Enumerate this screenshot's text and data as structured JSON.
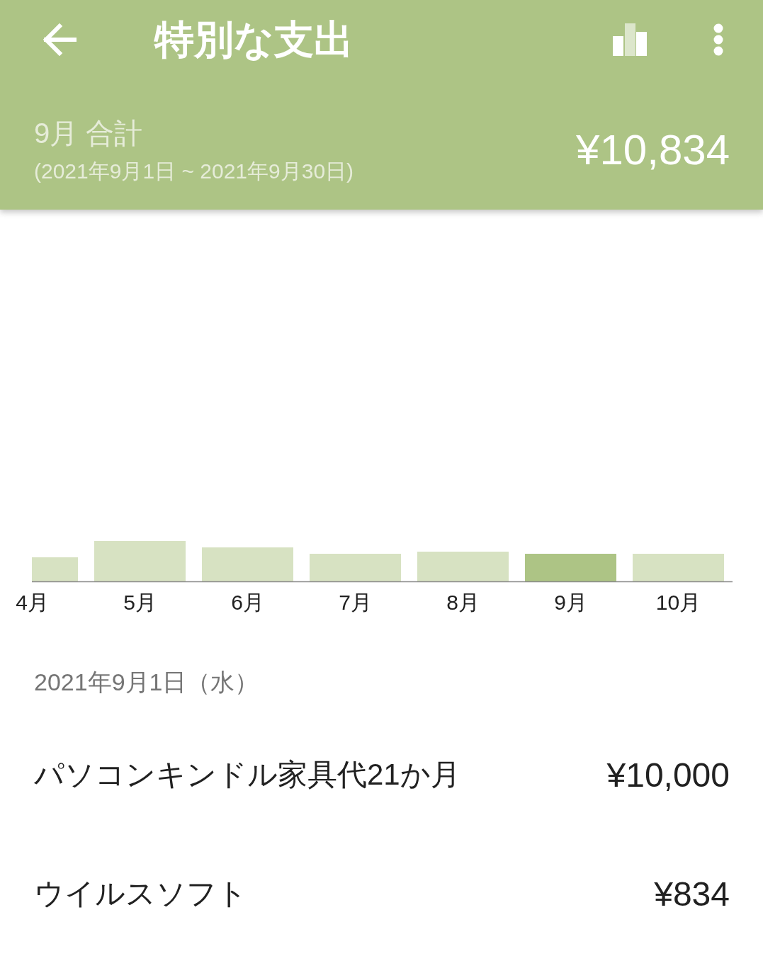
{
  "app_bar": {
    "title": "特別な支出"
  },
  "summary": {
    "label": "9月 合計",
    "period": "(2021年9月1日 ~ 2021年9月30日)",
    "total": "¥10,834"
  },
  "chart": {
    "bars": [
      {
        "label": "4月",
        "selected": false
      },
      {
        "label": "5月",
        "selected": false
      },
      {
        "label": "6月",
        "selected": false
      },
      {
        "label": "7月",
        "selected": false
      },
      {
        "label": "8月",
        "selected": false
      },
      {
        "label": "9月",
        "selected": true
      },
      {
        "label": "10月",
        "selected": false
      }
    ]
  },
  "entries": [
    {
      "date": "2021年9月1日（水）",
      "items": [
        {
          "name": "パソコンキンドル家具代21か月",
          "amount": "¥10,000"
        },
        {
          "name": "ウイルスソフト",
          "amount": "¥834"
        }
      ]
    }
  ]
}
